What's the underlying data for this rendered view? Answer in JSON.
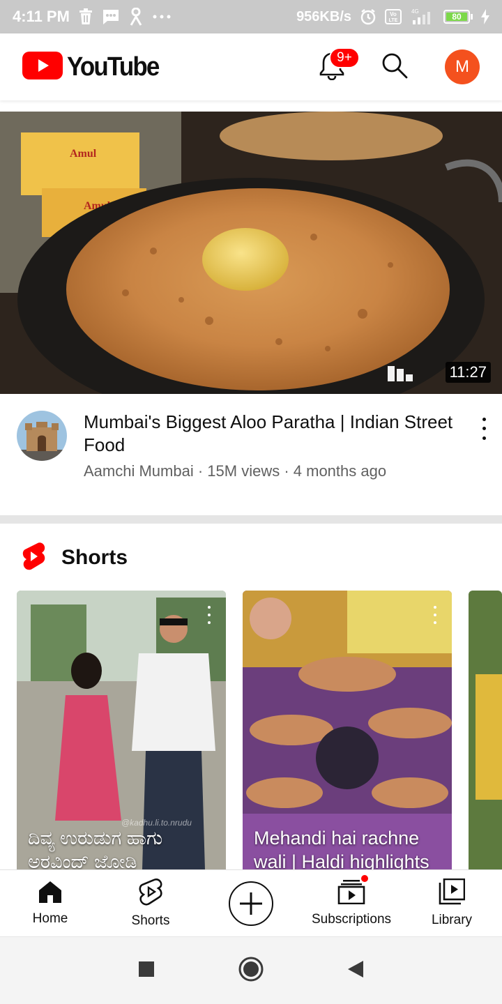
{
  "status_bar": {
    "time": "4:11 PM",
    "speed": "956KB/s",
    "battery": "80",
    "icons": [
      "trash-icon",
      "message-icon",
      "person-icon",
      "more-dots-icon",
      "alarm-icon",
      "volte-icon",
      "signal-icon",
      "battery-icon",
      "charging-icon"
    ]
  },
  "header": {
    "logo_text": "YouTube",
    "notification_badge": "9+",
    "account_initial": "M",
    "brand_color": "#ff0000",
    "avatar_color": "#f4511e"
  },
  "video": {
    "title": "Mumbai's Biggest Aloo Paratha | Indian Street Food",
    "channel": "Aamchi Mumbai",
    "views": "15M views",
    "age": "4 months ago",
    "separator": " · ",
    "duration": "11:27"
  },
  "shorts": {
    "heading": "Shorts",
    "items": [
      {
        "caption": "ದಿವ್ಯ ಉರುಡುಗ ಹಾಗು ಅರವಿಂದ್ ಜೋಡಿ",
        "watermark": "@kadhu.li.to.nrudu"
      },
      {
        "caption": "Mehandi hai rachne wali | Haldi highlights"
      }
    ]
  },
  "bottom_nav": {
    "home": "Home",
    "shorts": "Shorts",
    "subscriptions": "Subscriptions",
    "library": "Library"
  }
}
